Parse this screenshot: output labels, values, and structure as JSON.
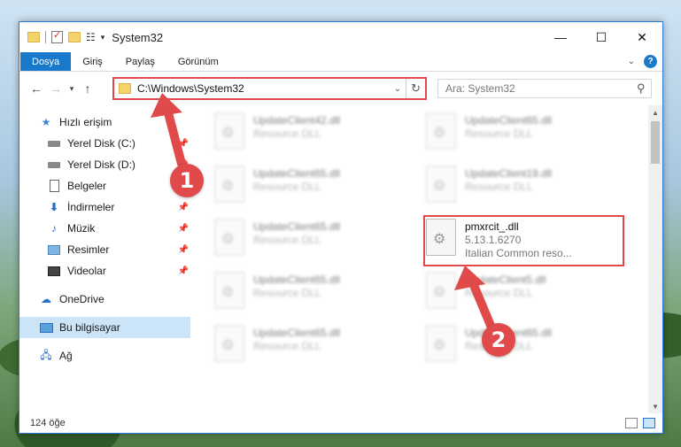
{
  "window": {
    "title": "System32",
    "controls": {
      "minimize": "—",
      "maximize": "☐",
      "close": "✕"
    }
  },
  "ribbon": {
    "tabs": [
      "Dosya",
      "Giriş",
      "Paylaş",
      "Görünüm"
    ],
    "help": "?"
  },
  "address": {
    "path": "C:\\Windows\\System32",
    "search_placeholder": "Ara: System32"
  },
  "nav": {
    "quick_access": "Hızlı erişim",
    "items": [
      {
        "label": "Yerel Disk (C:)",
        "icon": "drive-icon",
        "pinned": true
      },
      {
        "label": "Yerel Disk (D:)",
        "icon": "drive-icon",
        "pinned": true
      },
      {
        "label": "Belgeler",
        "icon": "documents-icon",
        "pinned": true
      },
      {
        "label": "İndirmeler",
        "icon": "download-icon",
        "pinned": true
      },
      {
        "label": "Müzik",
        "icon": "music-icon",
        "pinned": true
      },
      {
        "label": "Resimler",
        "icon": "pictures-icon",
        "pinned": true
      },
      {
        "label": "Videolar",
        "icon": "videos-icon",
        "pinned": true
      }
    ],
    "onedrive": "OneDrive",
    "this_pc": "Bu bilgisayar",
    "network": "Ağ"
  },
  "files": [
    {
      "name": "UpdateClient42.dll",
      "sub": "Resource DLL",
      "blurred": true
    },
    {
      "name": "UpdateClient65.dll",
      "sub": "Resource DLL",
      "blurred": true
    },
    {
      "name": "UpdateClient65.dll",
      "sub": "Resource DLL",
      "blurred": true
    },
    {
      "name": "UpdateClient19.dll",
      "sub": "Resource DLL",
      "blurred": true
    },
    {
      "name": "UpdateClient65.dll",
      "sub": "Resource DLL",
      "blurred": true
    },
    {
      "name": "pmxrcit_.dll",
      "sub": "5.13.1.6270",
      "sub2": "Italian Common reso...",
      "blurred": false
    },
    {
      "name": "UpdateClient65.dll",
      "sub": "Resource DLL",
      "blurred": true
    },
    {
      "name": "UpdateClient5.dll",
      "sub": "Resource DLL",
      "blurred": true
    },
    {
      "name": "UpdateClient65.dll",
      "sub": "Resource DLL",
      "blurred": true
    },
    {
      "name": "UpdateClient65.dll",
      "sub": "Resource DLL",
      "blurred": true
    }
  ],
  "status": {
    "count": "124 öğe"
  },
  "annotations": {
    "badge1": "1",
    "badge2": "2",
    "color": "#e04a4a"
  }
}
